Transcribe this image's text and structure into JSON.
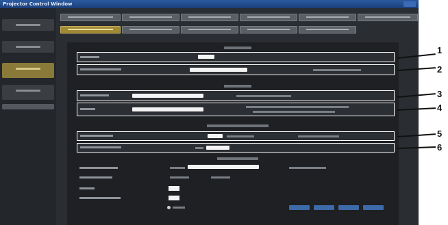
{
  "window": {
    "title": "Projector Control Window"
  },
  "callouts": [
    "1",
    "2",
    "3",
    "4",
    "5",
    "6"
  ],
  "colors": {
    "titlebar": "#2c5aa0",
    "active_tab": "#a08a34",
    "highlight_border": "#ffffff",
    "background": "#2a2d31"
  }
}
